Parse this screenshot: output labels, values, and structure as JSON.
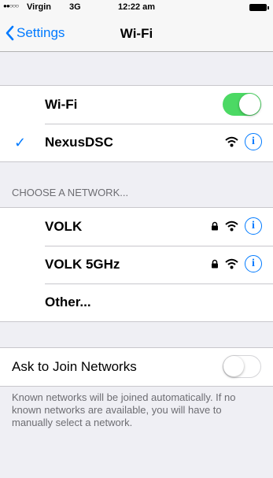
{
  "status_bar": {
    "signal": "●●○○○",
    "carrier": "Virgin",
    "network": "3G",
    "time": "12:22 am"
  },
  "nav": {
    "back_label": "Settings",
    "title": "Wi-Fi"
  },
  "wifi": {
    "label": "Wi-Fi",
    "enabled": true,
    "connected_network": "NexusDSC"
  },
  "networks": {
    "header": "CHOOSE A NETWORK...",
    "items": [
      {
        "name": "VOLK",
        "secured": true
      },
      {
        "name": "VOLK 5GHz",
        "secured": true
      }
    ],
    "other_label": "Other..."
  },
  "ask_to_join": {
    "label": "Ask to Join Networks",
    "enabled": false,
    "footer": "Known networks will be joined automatically. If no known networks are available, you will have to manually select a network."
  },
  "colors": {
    "accent": "#007aff",
    "toggle_on": "#4cd964",
    "background": "#efeff4"
  },
  "icons": {
    "info": "i",
    "checkmark": "✓"
  }
}
